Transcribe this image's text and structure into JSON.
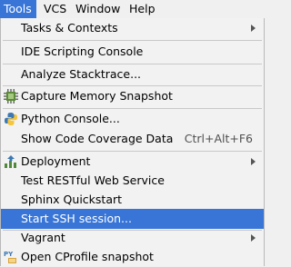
{
  "menubar": {
    "items": [
      {
        "label": "Tools"
      },
      {
        "label": "VCS"
      },
      {
        "label": "Window"
      },
      {
        "label": "Help"
      }
    ]
  },
  "menu": {
    "items": [
      {
        "label": "Tasks & Contexts"
      },
      {
        "label": "IDE Scripting Console"
      },
      {
        "label": "Analyze Stacktrace..."
      },
      {
        "label": "Capture Memory Snapshot",
        "icon": "memory-snapshot-icon"
      },
      {
        "label": "Python Console...",
        "icon": "python-icon"
      },
      {
        "label": "Show Code Coverage Data",
        "shortcut": "Ctrl+Alt+F6"
      },
      {
        "label": "Deployment",
        "icon": "deployment-icon"
      },
      {
        "label": "Test RESTful Web Service"
      },
      {
        "label": "Sphinx Quickstart"
      },
      {
        "label": "Start SSH session..."
      },
      {
        "label": "Vagrant"
      },
      {
        "label": "Open CProfile snapshot",
        "icon": "cprofile-icon"
      }
    ]
  },
  "colors": {
    "selection": "#3875d7",
    "menu_background": "#f2f2f2"
  }
}
